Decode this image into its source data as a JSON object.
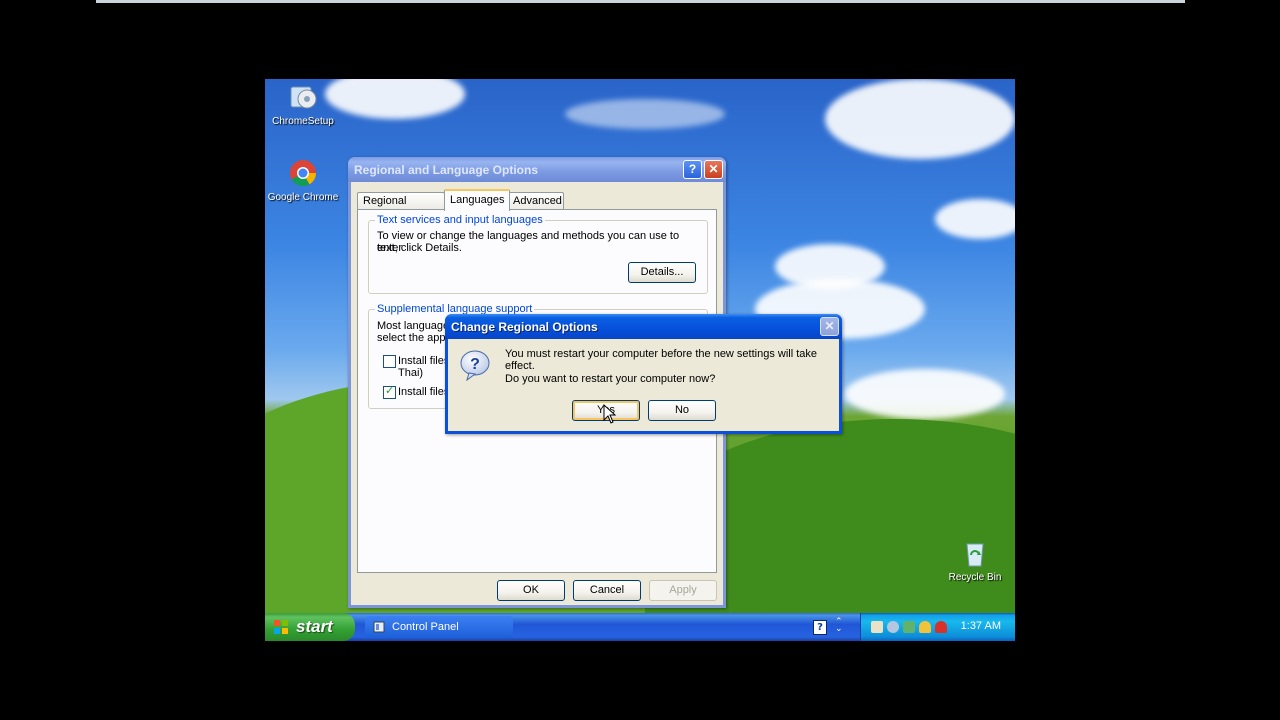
{
  "desktop": {
    "icons": [
      {
        "label": "ChromeSetup",
        "icon": "chrome-setup-icon"
      },
      {
        "label": "Google Chrome",
        "icon": "google-chrome-icon"
      },
      {
        "label": "Recycle Bin",
        "icon": "recycle-bin-icon"
      }
    ]
  },
  "regional_window": {
    "title": "Regional and Language Options",
    "help_glyph": "?",
    "close_glyph": "✕",
    "tabs": [
      {
        "label": "Regional Options"
      },
      {
        "label": "Languages",
        "selected": true
      },
      {
        "label": "Advanced"
      }
    ],
    "text_services": {
      "legend": "Text services and input languages",
      "body_line1": "To view or change the languages and methods you can use to enter",
      "body_line2": "text, click Details.",
      "details_button": "Details..."
    },
    "supplemental": {
      "legend": "Supplemental language support",
      "body_line1": "Most languages",
      "body_line2": "select the appro",
      "checkbox1_label": "Install files",
      "checkbox1_label_line2": "Thai)",
      "checkbox1_checked": false,
      "checkbox2_label": "Install files",
      "checkbox2_checked": true
    },
    "buttons": {
      "ok": "OK",
      "cancel": "Cancel",
      "apply": "Apply"
    }
  },
  "dialog": {
    "title": "Change Regional Options",
    "close_glyph": "✕",
    "message_line1": "You must restart your computer before the new settings will take effect.",
    "message_line2": "Do you want to restart your computer now?",
    "yes_button": "Yes",
    "no_button": "No"
  },
  "taskbar": {
    "start_label": "start",
    "task_label": "Control Panel",
    "help_glyph": "?",
    "clock": "1:37 AM"
  }
}
